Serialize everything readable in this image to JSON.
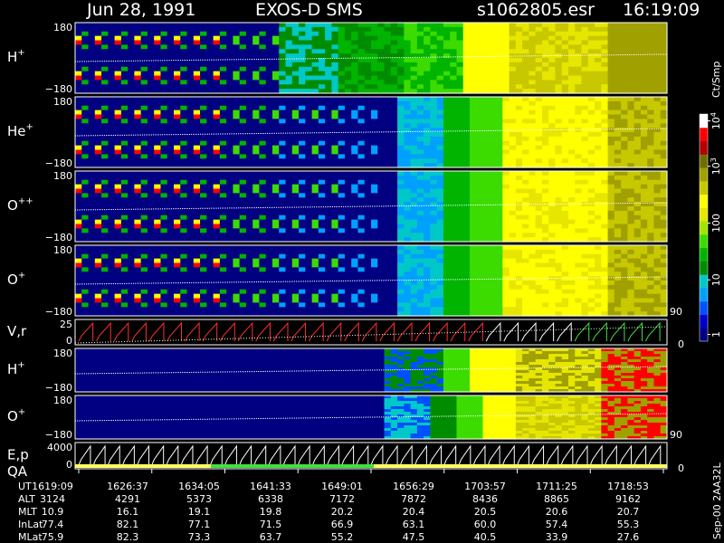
{
  "header": {
    "date": "Jun 28, 1991",
    "instrument": "EXOS-D SMS",
    "file": "s1062805.esr",
    "time": "16:19:09"
  },
  "side_note": "Sep-00 2AA32L",
  "colorbar": {
    "unit": "Ct/Smp",
    "scale": "log",
    "tick_labels": [
      "1",
      "10",
      "100",
      "10^3",
      "10^4"
    ],
    "colors": [
      "#000080",
      "#0000c8",
      "#0050ff",
      "#00a0ff",
      "#00c8c8",
      "#008c00",
      "#00b400",
      "#3cdc00",
      "#a0e600",
      "#e6e600",
      "#ffff00",
      "#c8c800",
      "#a0a000",
      "#6e6e00",
      "#b40000",
      "#ff0000",
      "#ffffff"
    ]
  },
  "panels": [
    {
      "label": "H",
      "sup": "+",
      "ymax": "180",
      "ymin": "−180"
    },
    {
      "label": "He",
      "sup": "+",
      "ymax": "180",
      "ymin": "−180"
    },
    {
      "label": "O",
      "sup": "++",
      "ymax": "180",
      "ymin": "−180"
    },
    {
      "label": "O",
      "sup": "+",
      "ymax": "180",
      "ymin": "−180"
    },
    {
      "label": "V,r",
      "sup": "",
      "ymax": "25",
      "ymin": "0",
      "right_top": "90",
      "right_bottom": "0"
    },
    {
      "label": "H",
      "sup": "+",
      "ymax": "180",
      "ymin": "−180"
    },
    {
      "label": "O",
      "sup": "+",
      "ymax": "180",
      "ymin": "−180"
    },
    {
      "label": "E,p",
      "label2": "QA",
      "sup": "",
      "ymax": "4000",
      "ymin": "0",
      "right_top": "90",
      "right_bottom": "0"
    }
  ],
  "table": {
    "labels": [
      "UT",
      "ALT",
      "MLT",
      "InLat",
      "MLat"
    ],
    "columns": [
      {
        "UT": "1619:09",
        "ALT": "3124",
        "MLT": "10.9",
        "InLat": "77.4",
        "MLat": "75.9"
      },
      {
        "UT": "1626:37",
        "ALT": "4291",
        "MLT": "16.1",
        "InLat": "82.1",
        "MLat": "82.3"
      },
      {
        "UT": "1634:05",
        "ALT": "5373",
        "MLT": "19.1",
        "InLat": "77.1",
        "MLat": "73.3"
      },
      {
        "UT": "1641:33",
        "ALT": "6338",
        "MLT": "19.8",
        "InLat": "71.5",
        "MLat": "63.7"
      },
      {
        "UT": "1649:01",
        "ALT": "7172",
        "MLT": "20.2",
        "InLat": "66.9",
        "MLat": "55.2"
      },
      {
        "UT": "1656:29",
        "ALT": "7872",
        "MLT": "20.4",
        "InLat": "63.1",
        "MLat": "47.5"
      },
      {
        "UT": "1703:57",
        "ALT": "8436",
        "MLT": "20.5",
        "InLat": "60.0",
        "MLat": "40.5"
      },
      {
        "UT": "1711:25",
        "ALT": "8865",
        "MLT": "20.6",
        "InLat": "57.4",
        "MLat": "33.9"
      },
      {
        "UT": "1718:53",
        "ALT": "9162",
        "MLT": "20.7",
        "InLat": "55.3",
        "MLat": "27.6"
      }
    ]
  },
  "chart_data": {
    "type": "heatmap",
    "x_axis": "UT",
    "x_ticks": [
      "1619:09",
      "1626:37",
      "1634:05",
      "1641:33",
      "1649:01",
      "1656:29",
      "1703:57",
      "1711:25",
      "1718:53"
    ],
    "color_scale": "log",
    "panels": [
      {
        "species": "H+",
        "y_range": [
          -180,
          180
        ]
      },
      {
        "species": "He+",
        "y_range": [
          -180,
          180
        ]
      },
      {
        "species": "O++",
        "y_range": [
          -180,
          180
        ]
      },
      {
        "species": "O+",
        "y_range": [
          -180,
          180
        ]
      },
      {
        "quantity": "V,r",
        "y_range": [
          0,
          25
        ],
        "right_range": [
          0,
          90
        ]
      },
      {
        "species": "H+",
        "y_range": [
          -180,
          180
        ]
      },
      {
        "species": "O+",
        "y_range": [
          -180,
          180
        ]
      },
      {
        "quantity": "E,p / QA",
        "y_range": [
          0,
          4000
        ],
        "right_range": [
          0,
          90
        ]
      }
    ]
  }
}
